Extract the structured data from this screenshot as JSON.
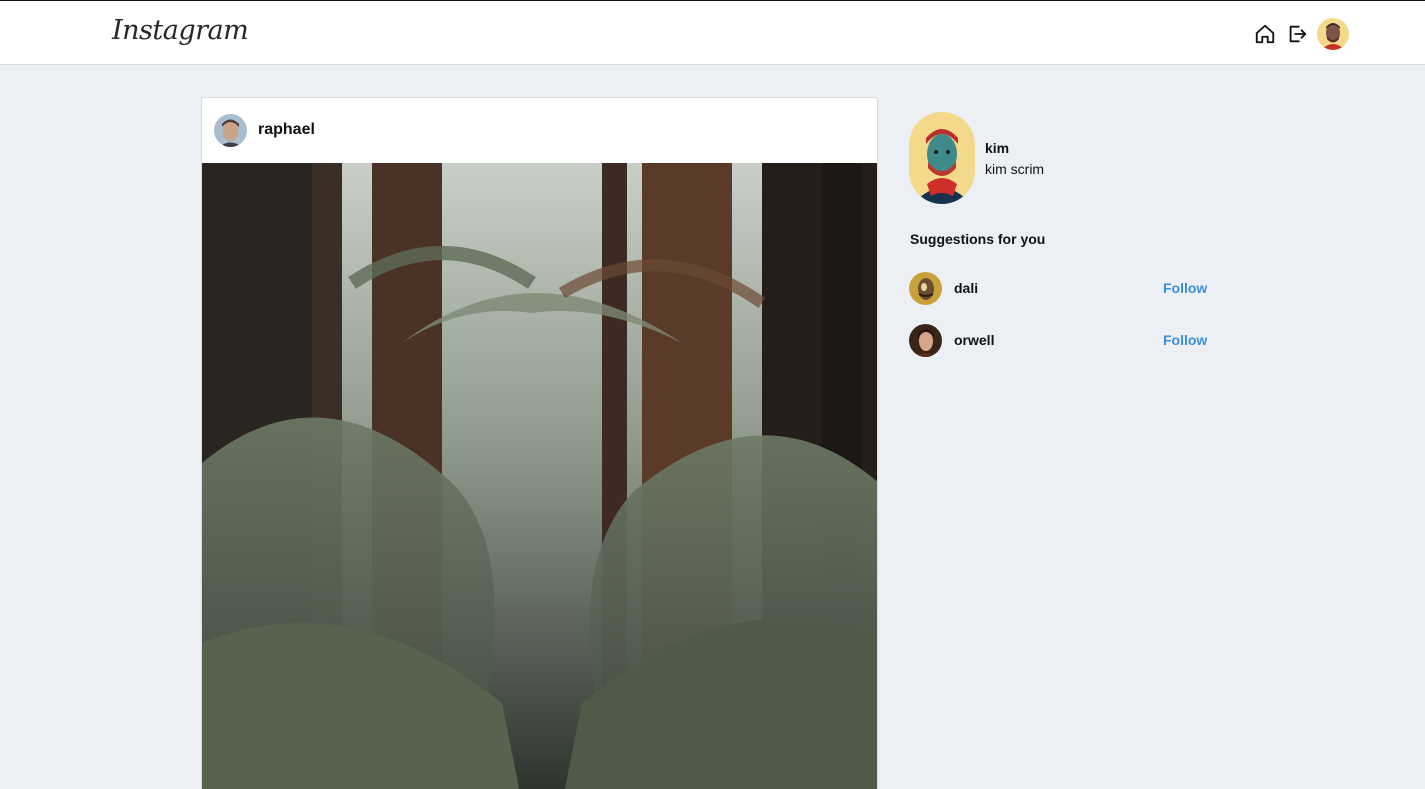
{
  "header": {
    "logo_text": "Instagram",
    "icons": [
      "home-icon",
      "logout-icon",
      "profile-avatar"
    ]
  },
  "post": {
    "username": "raphael",
    "image": "forest-photo"
  },
  "sidebar": {
    "user": {
      "username": "kim",
      "full_name": "kim scrim"
    },
    "suggestions_title": "Suggestions for you",
    "suggestions": [
      {
        "username": "dali",
        "action": "Follow"
      },
      {
        "username": "orwell",
        "action": "Follow"
      }
    ]
  },
  "colors": {
    "page_background": "#ecf0f4",
    "follow_link": "#3b8fd9",
    "surface": "#ffffff",
    "border": "#dbdbdb"
  }
}
